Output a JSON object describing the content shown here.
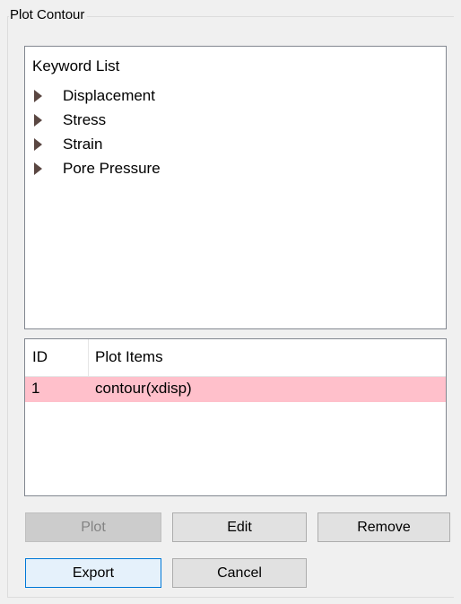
{
  "group": {
    "title": "Plot Contour"
  },
  "keywords": {
    "header": "Keyword List",
    "items": [
      {
        "label": "Displacement"
      },
      {
        "label": "Stress"
      },
      {
        "label": "Strain"
      },
      {
        "label": "Pore Pressure"
      }
    ]
  },
  "plot_list": {
    "columns": {
      "id": "ID",
      "items": "Plot Items"
    },
    "rows": [
      {
        "id": "1",
        "item": "contour(xdisp)",
        "highlight": "#ffc0cb"
      }
    ]
  },
  "buttons": {
    "plot": "Plot",
    "edit": "Edit",
    "remove": "Remove",
    "export": "Export",
    "cancel": "Cancel"
  },
  "colors": {
    "row_highlight": "#ffc0cb",
    "focus_border": "#0078d7",
    "tree_arrow": "#5a4742"
  }
}
